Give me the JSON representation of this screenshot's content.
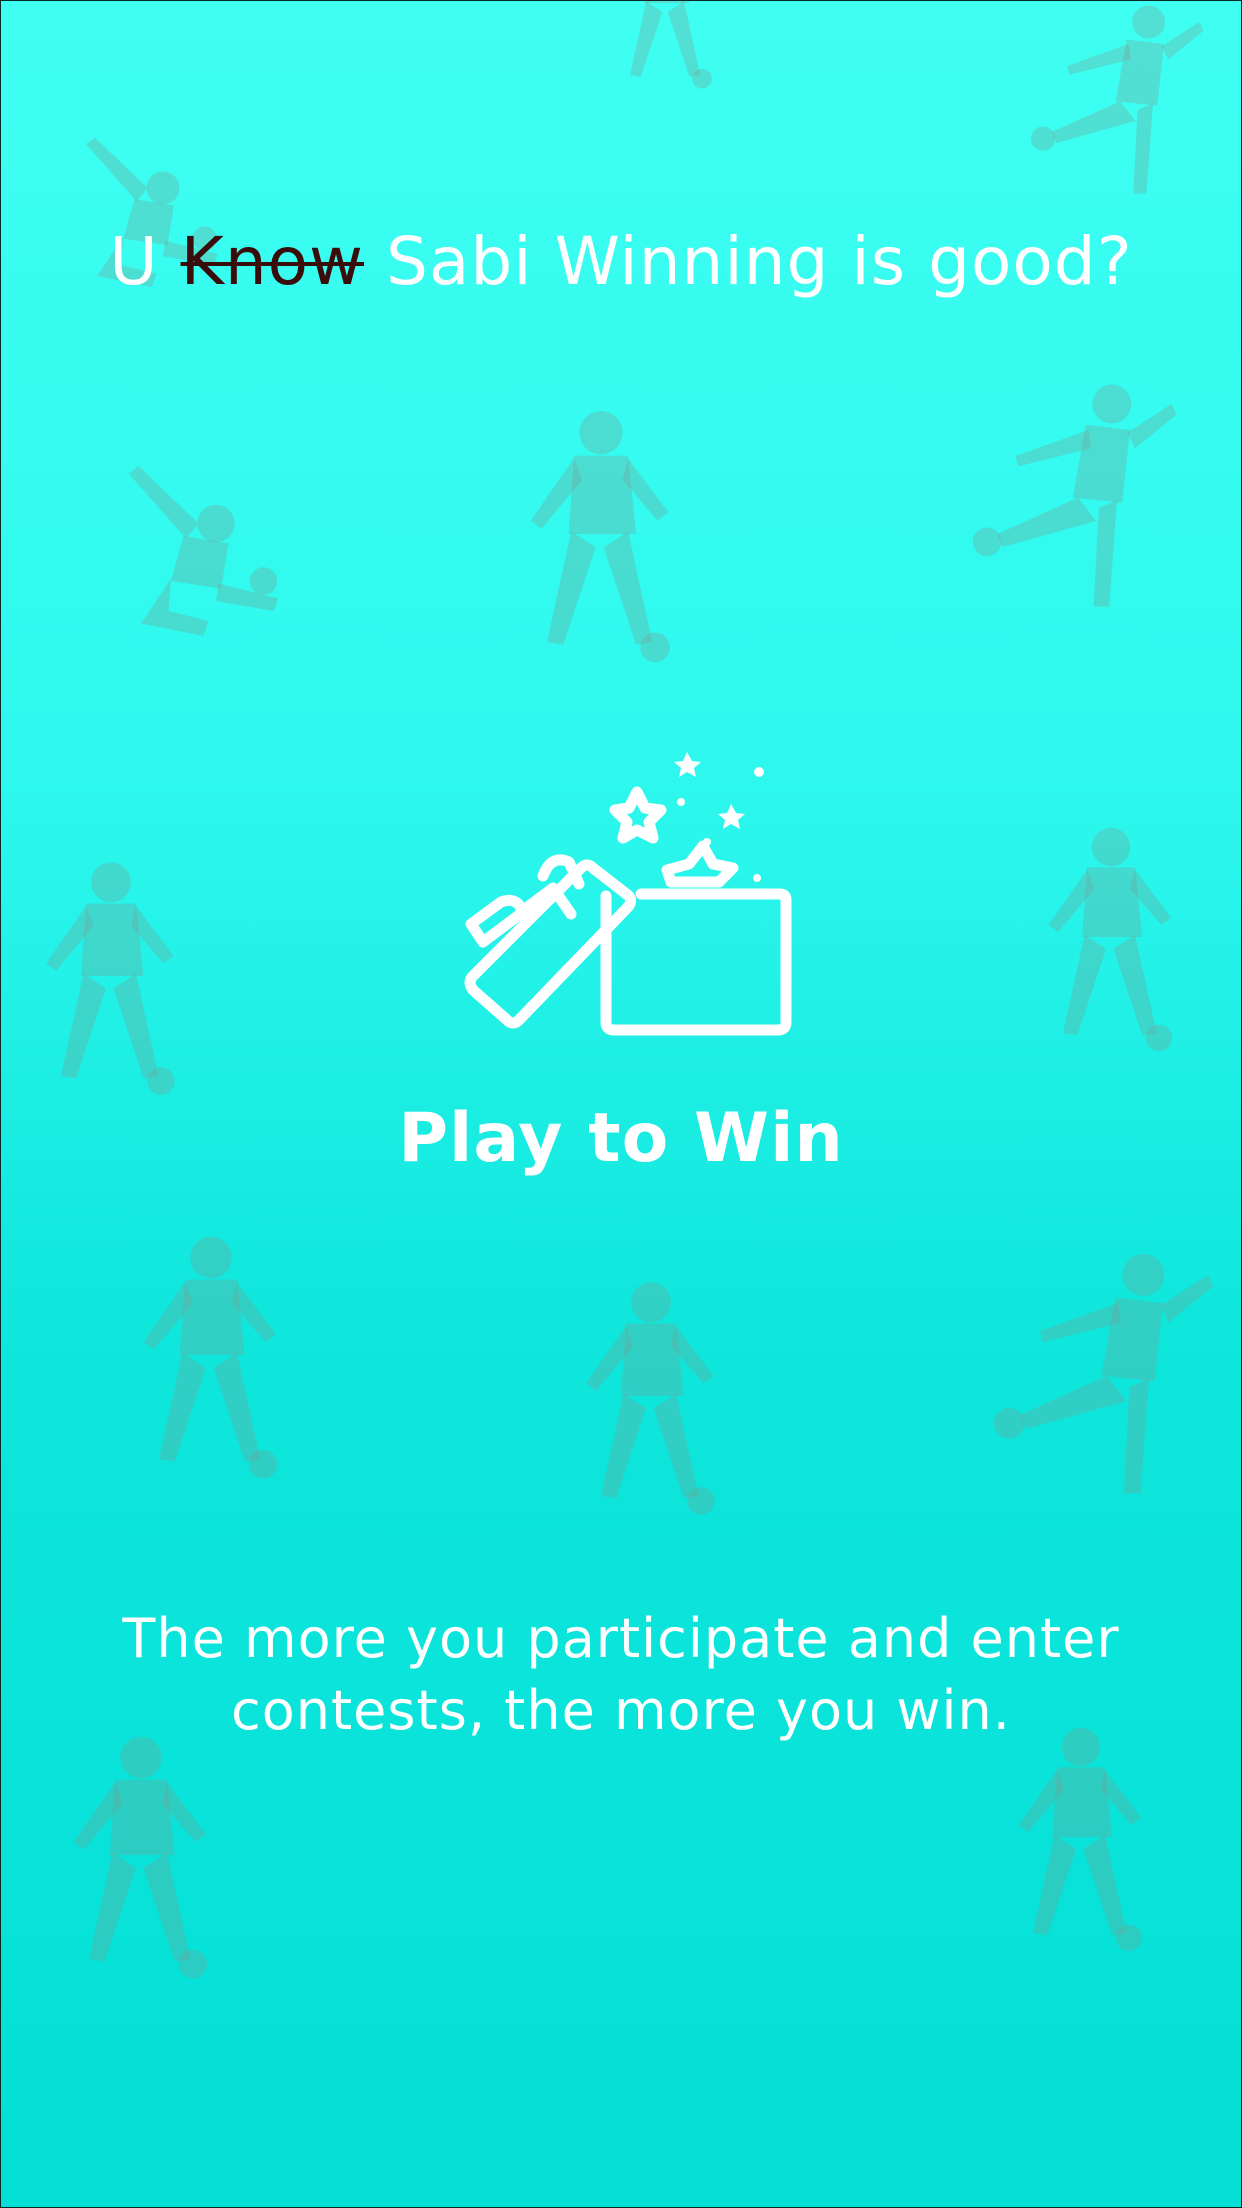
{
  "tagline": {
    "prefix": "U",
    "struck": "Know",
    "suffix": "Sabi Winning is good?"
  },
  "gift_icon": "gift-box-open-icon",
  "background_icon": "football-player-silhouette-icon",
  "headline": "Play to Win",
  "description": "The more you participate and enter contests, the more you win.",
  "colors": {
    "gradient_top": "#3ffff2",
    "gradient_bottom": "#04e0d6",
    "text": "#ffffff",
    "struck_text": "#3a0d0d"
  }
}
